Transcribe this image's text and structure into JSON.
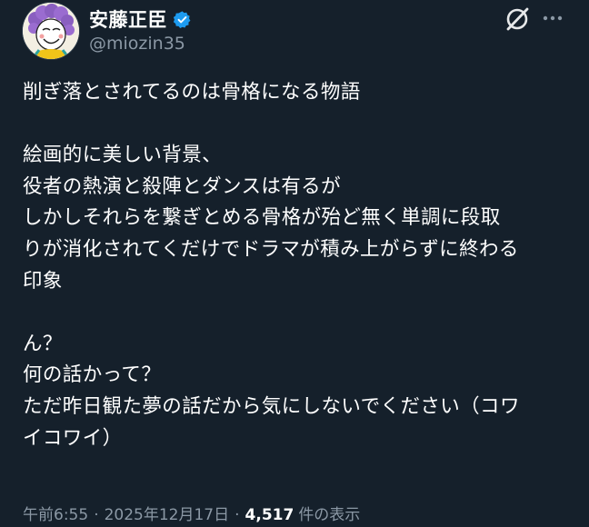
{
  "author": {
    "display_name": "安藤正臣",
    "handle": "@miozin35",
    "verified": true,
    "verified_color": "#1d9bf0"
  },
  "header_actions": {
    "grok_icon": "grok-icon",
    "more_icon": "more-options-icon"
  },
  "tweet": {
    "text": "削ぎ落とされてるのは骨格になる物語\n\n絵画的に美しい背景、\n役者の熱演と殺陣とダンスは有るが\nしかしそれらを繋ぎとめる骨格が殆ど無く単調に段取\nりが消化されてくだけでドラマが積み上がらずに終わる\n印象\n\nん？\n何の話かって？\nただ昨日観た夢の話だから気にしないでください（コワ\nイコワイ）"
  },
  "meta": {
    "time": "午前6:55",
    "separator": "·",
    "date": "2025年12月17日",
    "view_count": "4,517",
    "view_label": "件の表示"
  },
  "colors": {
    "background": "#15202b",
    "text": "#ffffff",
    "secondary_text": "#8b98a5"
  }
}
